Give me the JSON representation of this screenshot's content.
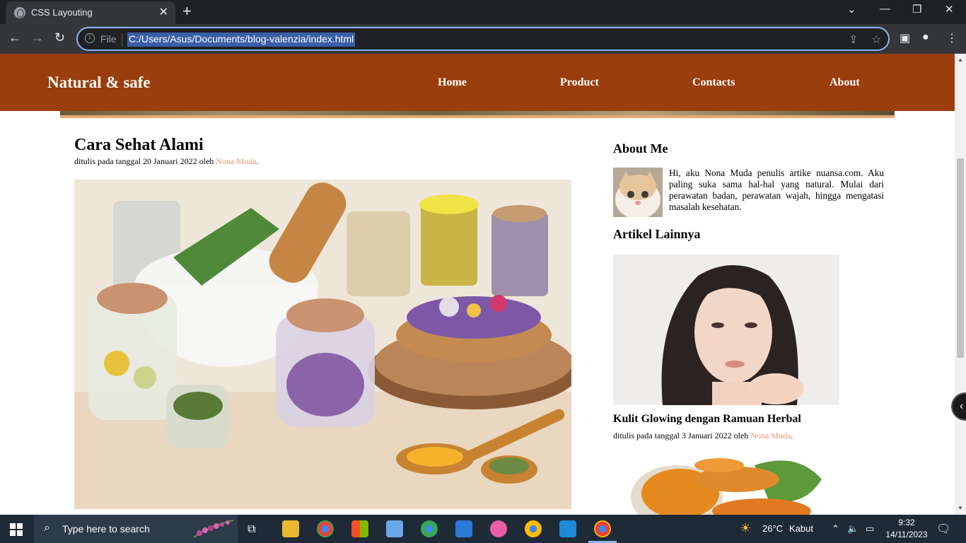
{
  "browser": {
    "tab_title": "CSS Layouting",
    "url_scheme": "File",
    "url": "C:/Users/Asus/Documents/blog-valenzia/index.html"
  },
  "site": {
    "brand": "Natural & safe",
    "nav": [
      "Home",
      "Product",
      "Contacts",
      "About"
    ]
  },
  "post": {
    "title": "Cara Sehat Alami",
    "meta_prefix": "ditulis pada tanggal 20 Januari 2022 oleh ",
    "author": "Nona Muda",
    "meta_suffix": "."
  },
  "sidebar": {
    "about_title": "About Me",
    "about_text": "Hi, aku Nona Muda penulis artike nuansa.com. Aku paling suka sama hal-hal yang natural. Mulai dari perawatan badan, perawatan wajah, hingga mengatasi masalah kesehatan.",
    "other_title": "Artikel Lainnya",
    "article": {
      "title": "Kulit Glowing dengan Ramuan Herbal",
      "meta_prefix": "ditulis pada tanggal 3 Januari 2022 oleh ",
      "author": "Nona Muda",
      "meta_suffix": "."
    }
  },
  "taskbar": {
    "search_placeholder": "Type here to search",
    "weather_temp": "26°C",
    "weather_text": "Kabut",
    "time": "9:32",
    "date": "14/11/2023"
  },
  "colors": {
    "header_bg": "#993e0c",
    "author_link": "#e8946c",
    "accent_strip": "#e6a871"
  }
}
